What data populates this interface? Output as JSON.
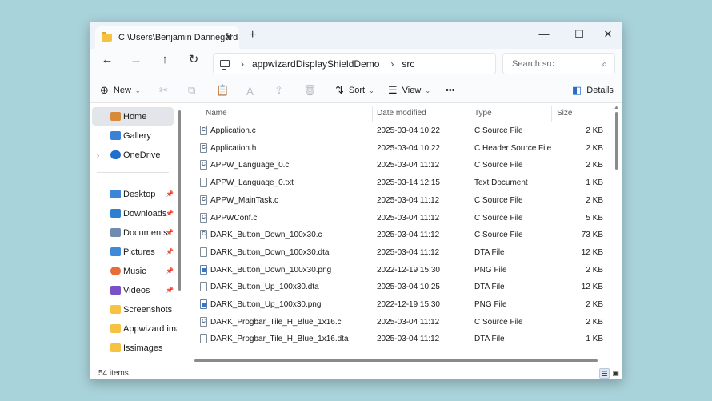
{
  "window": {
    "tab_title": "C:\\Users\\Benjamin Dannegård",
    "tab_close": "✕",
    "new_tab": "+",
    "minimize": "—",
    "maximize": "☐",
    "close": "✕"
  },
  "nav": {
    "back": "←",
    "forward": "→",
    "up": "↑",
    "refresh": "↻",
    "breadcrumb_sep": "›",
    "breadcrumbs": [
      "appwizardDisplayShieldDemo",
      "src"
    ],
    "search_placeholder": "Search src",
    "search_icon": "⌕"
  },
  "toolbar": {
    "new_label": "New",
    "sort_label": "Sort",
    "view_label": "View",
    "more_label": "•••",
    "details_label": "Details",
    "caret": "⌄",
    "icons": {
      "new": "⊕",
      "cut": "✂",
      "copy": "⧉",
      "paste": "📋",
      "rename": "Ａ",
      "share": "⇪",
      "delete": "🗑",
      "sort": "⇅",
      "view": "☰",
      "details": "◧"
    }
  },
  "sidebar": {
    "items": [
      {
        "label": "Home",
        "icon": "home-icon",
        "color": "#d88a3a"
      },
      {
        "label": "Gallery",
        "icon": "gallery-icon",
        "color": "#3b82d4"
      },
      {
        "label": "OneDrive",
        "icon": "cloud-icon",
        "color": "#1f6fd1"
      },
      {
        "label": "Desktop",
        "icon": "desktop-icon",
        "color": "#3a86d8"
      },
      {
        "label": "Downloads",
        "icon": "download-icon",
        "color": "#2f7fd0"
      },
      {
        "label": "Documents",
        "icon": "documents-icon",
        "color": "#6f8bb0"
      },
      {
        "label": "Pictures",
        "icon": "pictures-icon",
        "color": "#3f8ad8"
      },
      {
        "label": "Music",
        "icon": "music-icon",
        "color": "#e86c3a"
      },
      {
        "label": "Videos",
        "icon": "videos-icon",
        "color": "#7a4fc8"
      },
      {
        "label": "Screenshots",
        "icon": "folder-icon",
        "color": "#f5c242"
      },
      {
        "label": "Appwizard imag",
        "icon": "folder-icon",
        "color": "#f5c242"
      },
      {
        "label": "Issimages",
        "icon": "folder-icon",
        "color": "#f5c242"
      }
    ],
    "expand_glyph": "›",
    "pin_glyph": "📌"
  },
  "columns": {
    "name": "Name",
    "date": "Date modified",
    "type": "Type",
    "size": "Size",
    "sort_arrow": "⌃"
  },
  "files": [
    {
      "name": "Application.c",
      "date": "2025-03-04 10:22",
      "type": "C Source File",
      "size": "2 KB",
      "kind": "c"
    },
    {
      "name": "Application.h",
      "date": "2025-03-04 10:22",
      "type": "C Header Source File",
      "size": "2 KB",
      "kind": "c"
    },
    {
      "name": "APPW_Language_0.c",
      "date": "2025-03-04 11:12",
      "type": "C Source File",
      "size": "2 KB",
      "kind": "c"
    },
    {
      "name": "APPW_Language_0.txt",
      "date": "2025-03-14 12:15",
      "type": "Text Document",
      "size": "1 KB",
      "kind": "txt"
    },
    {
      "name": "APPW_MainTask.c",
      "date": "2025-03-04 11:12",
      "type": "C Source File",
      "size": "2 KB",
      "kind": "c"
    },
    {
      "name": "APPWConf.c",
      "date": "2025-03-04 11:12",
      "type": "C Source File",
      "size": "5 KB",
      "kind": "c"
    },
    {
      "name": "DARK_Button_Down_100x30.c",
      "date": "2025-03-04 11:12",
      "type": "C Source File",
      "size": "73 KB",
      "kind": "c"
    },
    {
      "name": "DARK_Button_Down_100x30.dta",
      "date": "2025-03-04 11:12",
      "type": "DTA File",
      "size": "12 KB",
      "kind": "dta"
    },
    {
      "name": "DARK_Button_Down_100x30.png",
      "date": "2022-12-19 15:30",
      "type": "PNG File",
      "size": "2 KB",
      "kind": "png"
    },
    {
      "name": "DARK_Button_Up_100x30.dta",
      "date": "2025-03-04 10:25",
      "type": "DTA File",
      "size": "12 KB",
      "kind": "dta"
    },
    {
      "name": "DARK_Button_Up_100x30.png",
      "date": "2022-12-19 15:30",
      "type": "PNG File",
      "size": "2 KB",
      "kind": "png"
    },
    {
      "name": "DARK_Progbar_Tile_H_Blue_1x16.c",
      "date": "2025-03-04 11:12",
      "type": "C Source File",
      "size": "2 KB",
      "kind": "c"
    },
    {
      "name": "DARK_Progbar_Tile_H_Blue_1x16.dta",
      "date": "2025-03-04 11:12",
      "type": "DTA File",
      "size": "1 KB",
      "kind": "dta"
    }
  ],
  "status": {
    "item_count": "54 items",
    "view_details": "☰",
    "view_tiles": "▣"
  }
}
